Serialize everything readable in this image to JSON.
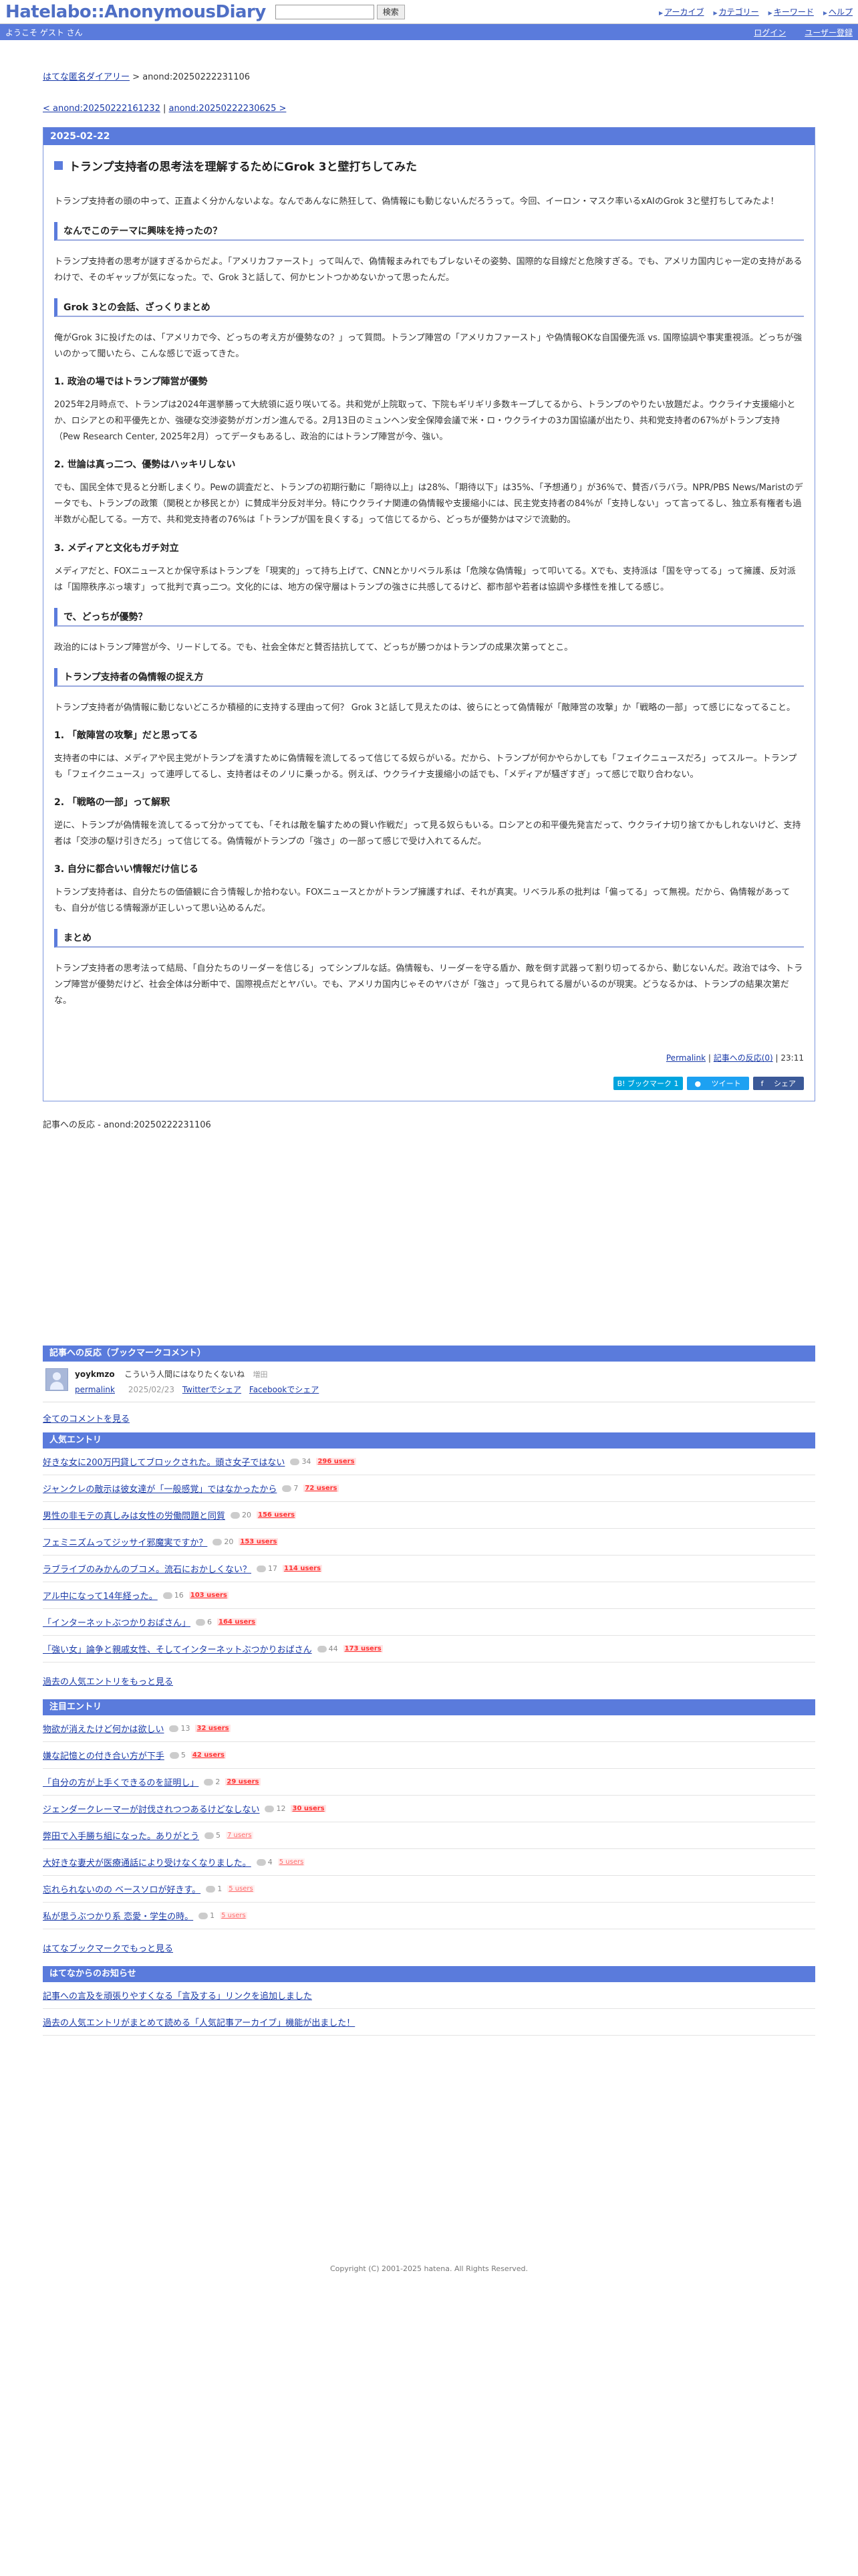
{
  "header": {
    "logo": "Hatelabo::AnonymousDiary",
    "search_button": "検索",
    "nav": [
      "アーカイブ",
      "カテゴリー",
      "キーワード",
      "ヘルプ"
    ]
  },
  "welcome": {
    "text": "ようこそ ゲスト さん",
    "login": "ログイン",
    "register": "ユーザー登録"
  },
  "breadcrumb": {
    "site": "はてな匿名ダイアリー",
    "sep": " > ",
    "current": "anond:20250222231106"
  },
  "pager": {
    "prev": "< anond:20250222161232",
    "sep": " | ",
    "next": "anond:20250222230625 >"
  },
  "entry": {
    "date": "2025-02-22",
    "title": "トランプ支持者の思考法を理解するためにGrok 3と壁打ちしてみた",
    "intro": "トランプ支持者の頭の中って、正直よく分かんないよな。なんであんなに熱狂して、偽情報にも動じないんだろうって。今回、イーロン・マスク率いるxAIのGrok 3と壁打ちしてみたよ！",
    "s1_title": "なんでこのテーマに興味を持ったの？",
    "s1_text": "トランプ支持者の思考が謎すぎるからだよ。「アメリカファースト」って叫んで、偽情報まみれでもブレないその姿勢、国際的な目線だと危険すぎる。でも、アメリカ国内じゃ一定の支持があるわけで、そのギャップが気になった。で、Grok 3と話して、何かヒントつかめないかって思ったんだ。",
    "s2_title": "Grok 3との会話、ざっくりまとめ",
    "s2_text": "俺がGrok 3に投げたのは、「アメリカで今、どっちの考え方が優勢なの？」って質問。トランプ陣営の「アメリカファースト」や偽情報OKな自国優先派 vs. 国際協調や事実重視派。どっちが強いのかって聞いたら、こんな感じで返ってきた。",
    "p1_title": "1. 政治の場ではトランプ陣営が優勢",
    "p1_text": "2025年2月時点で、トランプは2024年選挙勝って大統領に返り咲いてる。共和党が上院取って、下院もギリギリ多数キープしてるから、トランプのやりたい放題だよ。ウクライナ支援縮小とか、ロシアとの和平優先とか、強硬な交渉姿勢がガンガン進んでる。2月13日のミュンヘン安全保障会議で米・ロ・ウクライナの3カ国協議が出たり、共和党支持者の67%がトランプ支持（Pew Research Center, 2025年2月）ってデータもあるし、政治的にはトランプ陣営が今、強い。",
    "p2_title": "2. 世論は真っ二つ、優勢はハッキリしない",
    "p2_text": "でも、国民全体で見ると分断しまくり。Pewの調査だと、トランプの初期行動に「期待以上」は28%、「期待以下」は35%、「予想通り」が36%で、賛否バラバラ。NPR/PBS News/Maristのデータでも、トランプの政策（関税とか移民とか）に賛成半分反対半分。特にウクライナ関連の偽情報や支援縮小には、民主党支持者の84%が「支持しない」って言ってるし、独立系有権者も過半数が心配してる。一方で、共和党支持者の76%は「トランプが国を良くする」って信じてるから、どっちが優勢かはマジで流動的。",
    "p3_title": "3. メディアと文化もガチ対立",
    "p3_text": "メディアだと、FOXニュースとか保守系はトランプを「現実的」って持ち上げて、CNNとかリベラル系は「危険な偽情報」って叩いてる。Xでも、支持派は「国を守ってる」って擁護、反対派は「国際秩序ぶっ壊す」って批判で真っ二つ。文化的には、地方の保守層はトランプの強さに共感してるけど、都市部や若者は協調や多様性を推してる感じ。",
    "s3_title": "で、どっちが優勢？",
    "s3_text": "政治的にはトランプ陣営が今、リードしてる。でも、社会全体だと賛否拮抗してて、どっちが勝つかはトランプの成果次第ってとこ。",
    "s4_title": "トランプ支持者の偽情報の捉え方",
    "s4_text": "トランプ支持者が偽情報に動じないどころか積極的に支持する理由って何？ Grok 3と話して見えたのは、彼らにとって偽情報が「敵陣営の攻撃」か「戦略の一部」って感じになってること。",
    "q1_title": "1. 「敵陣営の攻撃」だと思ってる",
    "q1_text": "支持者の中には、メディアや民主党がトランプを潰すために偽情報を流してるって信じてる奴らがいる。だから、トランプが何かやらかしても「フェイクニュースだろ」ってスルー。トランプも「フェイクニュース」って連呼してるし、支持者はそのノリに乗っかる。例えば、ウクライナ支援縮小の話でも、「メディアが騒ぎすぎ」って感じで取り合わない。",
    "q2_title": "2. 「戦略の一部」って解釈",
    "q2_text": "逆に、トランプが偽情報を流してるって分かってても、「それは敵を騙すための賢い作戦だ」って見る奴らもいる。ロシアとの和平優先発言だって、ウクライナ切り捨てかもしれないけど、支持者は「交渉の駆け引きだろ」って信じてる。偽情報がトランプの「強さ」の一部って感じで受け入れてるんだ。",
    "q3_title": "3. 自分に都合いい情報だけ信じる",
    "q3_text": "トランプ支持者は、自分たちの価値観に合う情報しか拾わない。FOXニュースとかがトランプ擁護すれば、それが真実。リベラル系の批判は「偏ってる」って無視。だから、偽情報があっても、自分が信じる情報源が正しいって思い込めるんだ。",
    "s5_title": "まとめ",
    "s5_text": "トランプ支持者の思考法って結局、「自分たちのリーダーを信じる」ってシンプルな話。偽情報も、リーダーを守る盾か、敵を倒す武器って割り切ってるから、動じないんだ。政治では今、トランプ陣営が優勢だけど、社会全体は分断中で、国際視点だとヤバい。でも、アメリカ国内じゃそのヤバさが「強さ」って見られてる層がいるのが現実。どうなるかは、トランプの結果次第だな。",
    "footer_permalink": "Permalink",
    "footer_sep": " | ",
    "footer_reactions": "記事への反応(0)",
    "footer_time": "23:11",
    "share_bookmark": "B! ブックマーク 1",
    "share_tweet": "ツイート",
    "share_facebook": "シェア"
  },
  "reactions_head": "記事への反応 - anond:20250222231106",
  "bookmarks": {
    "title": "記事への反応（ブックマークコメント）",
    "items": [
      {
        "user": "yoykmzo",
        "comment": "こういう人間にはなりたくないね",
        "tag": "増田",
        "permalink": "permalink",
        "date": "2025/02/23",
        "twitter": "Twitterでシェア",
        "facebook": "Facebookでシェア"
      }
    ],
    "all_comments": "全てのコメントを見る"
  },
  "popular": {
    "title": "人気エントリ",
    "items": [
      {
        "text": "好きな女に200万円貸してブロックされた。頭さ女子ではない",
        "comments": "34",
        "users": "296 users"
      },
      {
        "text": "ジャンクレの敵示は彼女達が「一般感覚」ではなかったから",
        "comments": "7",
        "users": "72 users"
      },
      {
        "text": "男性の非モテの真しみは女性の労働問題と同質",
        "comments": "20",
        "users": "156 users"
      },
      {
        "text": "フェミニズムってジッサイ邪魔実ですか？",
        "comments": "20",
        "users": "153 users"
      },
      {
        "text": "ラブライブのみかんのブコメ。流石におかしくない？",
        "comments": "17",
        "users": "114 users"
      },
      {
        "text": "アル中になって14年経った。",
        "comments": "16",
        "users": "103 users"
      },
      {
        "text": "「インターネットぶつかりおばさん」",
        "comments": "6",
        "users": "164 users"
      },
      {
        "text": "「強い女」論争と親戚女性、そしてインターネットぶつかりおばさん",
        "comments": "44",
        "users": "173 users"
      }
    ],
    "more": "過去の人気エントリをもっと見る"
  },
  "featured": {
    "title": "注目エントリ",
    "items": [
      {
        "text": "物欲が消えたけど何かは欲しい",
        "comments": "13",
        "users": "32 users"
      },
      {
        "text": "嫌な記憶との付き合い方が下手",
        "comments": "5",
        "users": "42 users"
      },
      {
        "text": "「自分の方が上手くできるのを証明し」",
        "comments": "2",
        "users": "29 users"
      },
      {
        "text": "ジェンダークレーマーが討伐されつつあるけどなしない",
        "comments": "12",
        "users": "30 users"
      },
      {
        "text": "弊田で入手勝ち組になった。ありがとう",
        "comments": "5",
        "users": "7 users"
      },
      {
        "text": "大好きな妻犬が医療通話により受けなくなりました。",
        "comments": "4",
        "users": "5 users"
      },
      {
        "text": "忘れられないのの ベースソロが好きす。",
        "comments": "1",
        "users": "5 users"
      },
      {
        "text": "私が思うぶつかり系 恋愛・学生の時。",
        "comments": "1",
        "users": "5 users"
      }
    ],
    "more": "はてなブックマークでもっと見る"
  },
  "notices": {
    "title": "はてなからのお知らせ",
    "items": [
      "記事への言及を頑張りやすくなる「言及する」リンクを追加しました",
      "過去の人気エントリがまとめて読める「人気記事アーカイブ」機能が出ました！"
    ]
  },
  "copyright": "Copyright (C) 2001-2025 hatena. All Rights Reserved."
}
